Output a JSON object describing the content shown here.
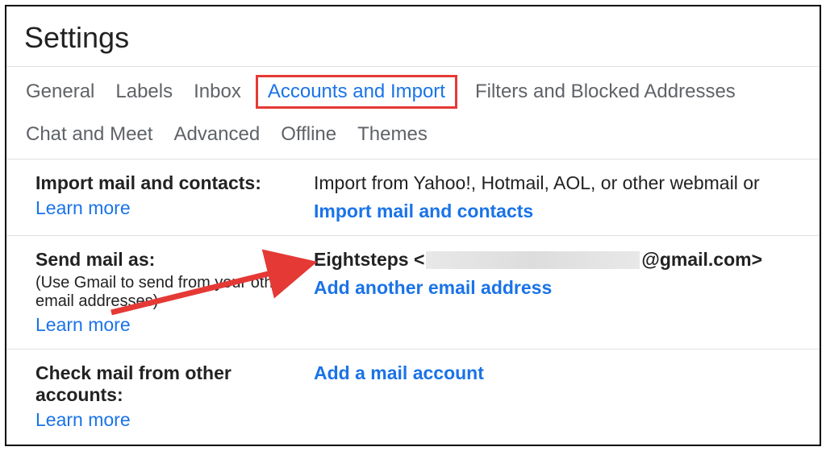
{
  "page_title": "Settings",
  "tabs": {
    "general": "General",
    "labels": "Labels",
    "inbox": "Inbox",
    "accounts_import": "Accounts and Import",
    "filters_blocked": "Filters and Blocked Addresses",
    "chat_meet": "Chat and Meet",
    "advanced": "Advanced",
    "offline": "Offline",
    "themes": "Themes"
  },
  "sections": {
    "import": {
      "heading": "Import mail and contacts:",
      "learn_more": "Learn more",
      "desc": "Import from Yahoo!, Hotmail, AOL, or other webmail or",
      "action": "Import mail and contacts"
    },
    "send_as": {
      "heading": "Send mail as:",
      "sub": "(Use Gmail to send from your other email addresses)",
      "learn_more": "Learn more",
      "name_prefix": "Eightsteps <",
      "domain_suffix": "@gmail.com>",
      "action": "Add another email address"
    },
    "check_mail": {
      "heading": "Check mail from other accounts:",
      "learn_more": "Learn more",
      "action": "Add a mail account"
    }
  }
}
